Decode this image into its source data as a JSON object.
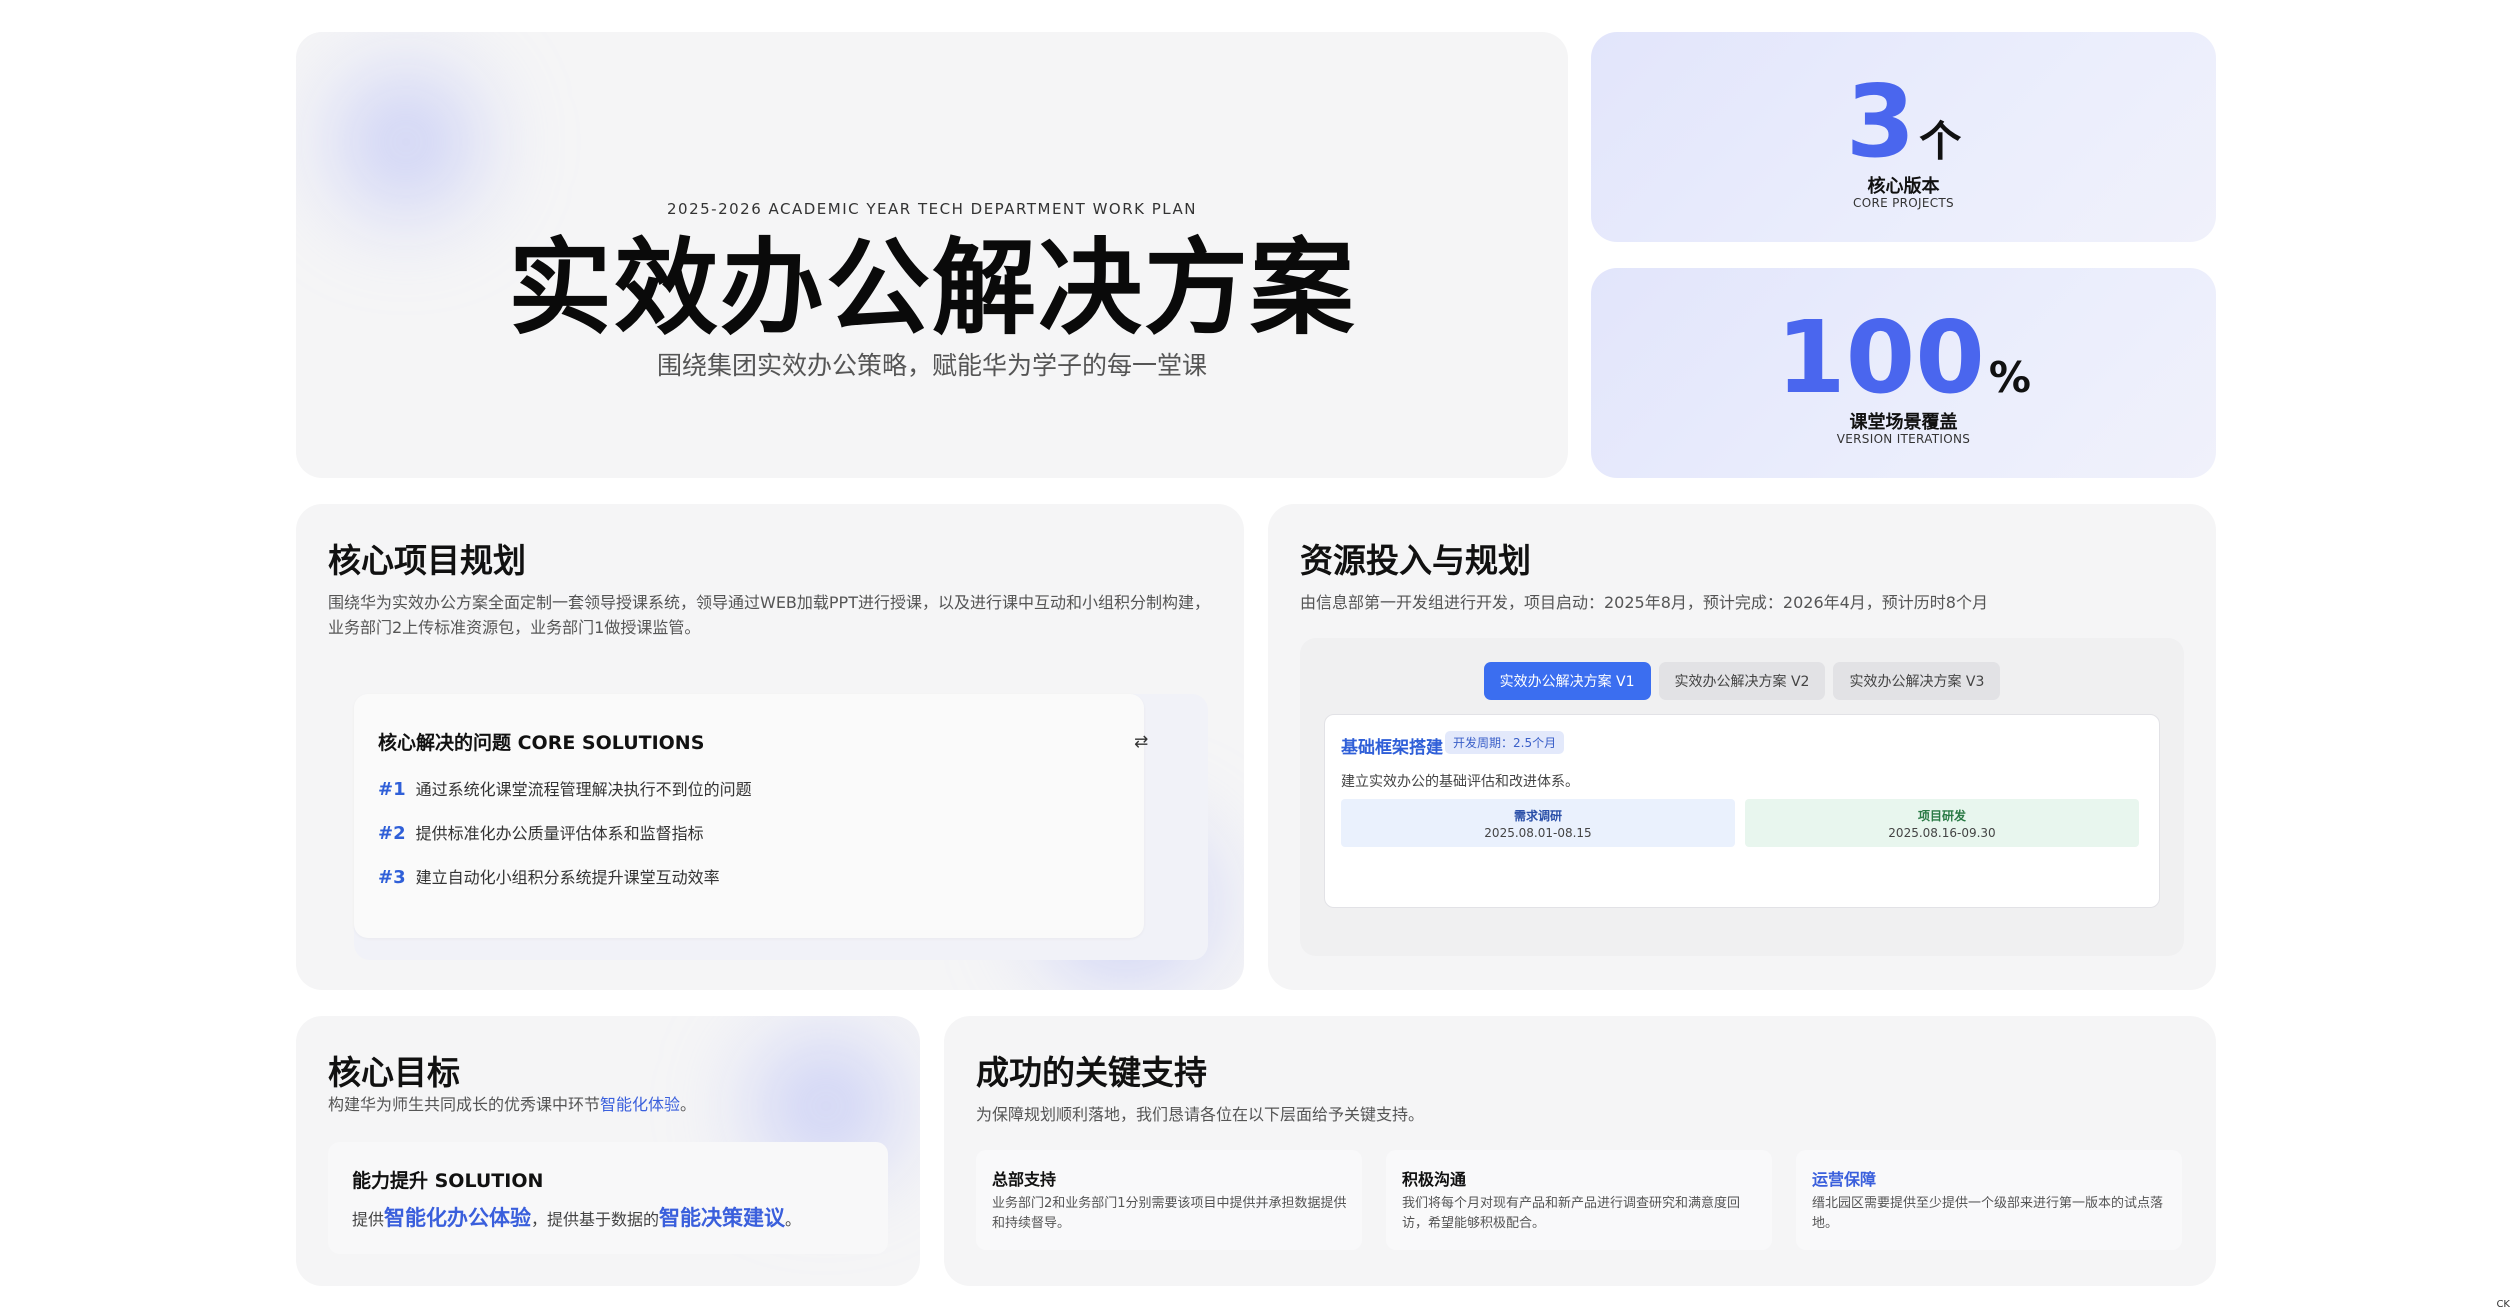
{
  "hero": {
    "eyebrow": "2025-2026 ACADEMIC YEAR TECH DEPARTMENT WORK PLAN",
    "title": "实效办公解决方案",
    "subtitle": "围绕集团实效办公策略，赋能华为学子的每一堂课"
  },
  "stats": [
    {
      "number": "3",
      "unit": "个",
      "label": "核心版本",
      "sub": "CORE PROJECTS"
    },
    {
      "number": "100",
      "unit": "%",
      "label": "课堂场景覆盖",
      "sub": "VERSION ITERATIONS"
    }
  ],
  "core": {
    "title": "核心项目规划",
    "desc_line1": "围绕华为实效办公方案全面定制一套领导授课系统，领导通过WEB加载PPT进行授课，以及进行课中互动和小组积分制构建，",
    "desc_line2": "业务部门2上传标准资源包，业务部门1做授课监管。",
    "solutions_title": "核心解决的问题 CORE SOLUTIONS",
    "swap_icon": "⇄",
    "items": [
      {
        "num": "#1",
        "text": "通过系统化课堂流程管理解决执行不到位的问题"
      },
      {
        "num": "#2",
        "text": "提供标准化办公质量评估体系和监督指标"
      },
      {
        "num": "#3",
        "text": "建立自动化小组积分系统提升课堂互动效率"
      }
    ]
  },
  "resources": {
    "title": "资源投入与规划",
    "desc": "由信息部第一开发组进行开发，项目启动：2025年8月，预计完成：2026年4月，预计历时8个月",
    "tabs": [
      "实效办公解决方案 V1",
      "实效办公解决方案 V2",
      "实效办公解决方案 V3"
    ],
    "active_tab": 0,
    "phase": {
      "title": "基础框架搭建",
      "badge": "开发周期：2.5个月",
      "desc": "建立实效办公的基础评估和改进体系。",
      "steps": [
        {
          "name": "需求调研",
          "date": "2025.08.01-08.15"
        },
        {
          "name": "项目研发",
          "date": "2025.08.16-09.30"
        }
      ]
    }
  },
  "goal": {
    "title": "核心目标",
    "desc_prefix": "构建华为师生共同成长的优秀课中环节",
    "desc_highlight": "智能化体验",
    "desc_suffix": "。",
    "box_title": "能力提升 SOLUTION",
    "box_prefix": "提供",
    "box_hl1": "智能化办公体验",
    "box_mid": "，提供基于数据的",
    "box_hl2": "智能决策建议",
    "box_suffix": "。"
  },
  "support": {
    "title": "成功的关键支持",
    "desc": "为保障规划顺利落地，我们恳请各位在以下层面给予关键支持。",
    "items": [
      {
        "title": "总部支持",
        "text": "业务部门2和业务部门1分别需要该项目中提供并承担数据提供和持续督导。"
      },
      {
        "title": "积极沟通",
        "text": "我们将每个月对现有产品和新产品进行调查研究和满意度回访，希望能够积极配合。"
      },
      {
        "title": "运营保障",
        "text": "缙北园区需要提供至少提供一个级部来进行第一版本的试点落地。"
      }
    ]
  },
  "corner_text": "CK",
  "colors": {
    "accent": "#4a66ee",
    "link": "#3a5fdc",
    "tab_active": "#3b6ef0"
  }
}
